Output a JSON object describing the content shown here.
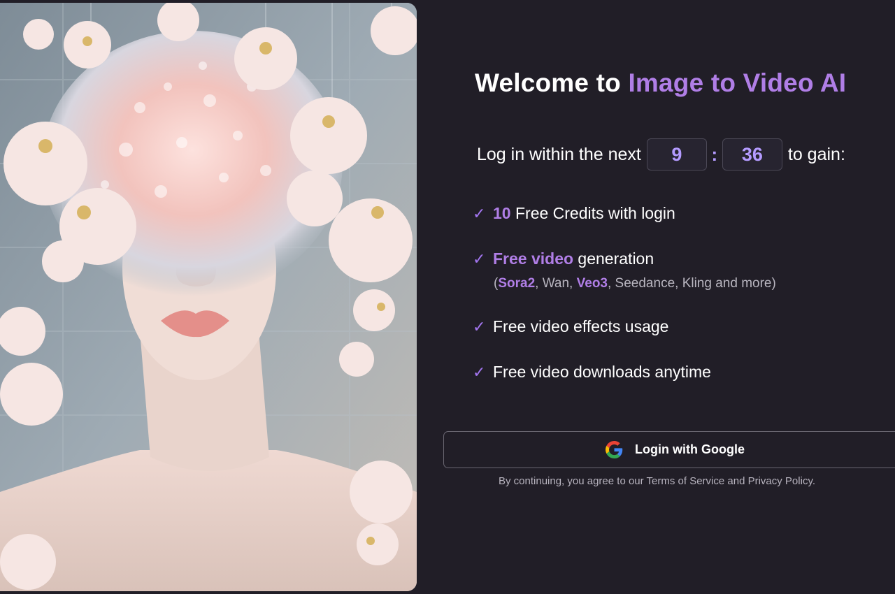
{
  "hero": {
    "image": "woman-with-glass-bubble-hair-and-flowers"
  },
  "welcome": {
    "prefix": "Welcome to ",
    "brand": "Image to Video AI"
  },
  "timer": {
    "prefix": "Log in within the next",
    "minutes": "9",
    "colon": ":",
    "seconds": "36",
    "suffix": "to gain:"
  },
  "benefits": [
    {
      "check": "✓",
      "accent": "10",
      "text": " Free Credits with login"
    },
    {
      "check": "✓",
      "accent": "Free video",
      "text": " generation"
    },
    {
      "check": "✓",
      "text": "Free video effects usage"
    },
    {
      "check": "✓",
      "text": "Free video downloads anytime"
    }
  ],
  "models": {
    "open": "(",
    "sora": "Sora2",
    "mid1": ", Wan, ",
    "veo": "Veo3",
    "rest": ", Seedance, Kling and more)"
  },
  "login": {
    "label": "Login with Google",
    "icon": "google-icon"
  },
  "terms": "By continuing, you agree to our Terms of Service and Privacy Policy.",
  "colors": {
    "accent": "#b07ee6",
    "background": "#211e27",
    "timer_text": "#b49bff"
  }
}
